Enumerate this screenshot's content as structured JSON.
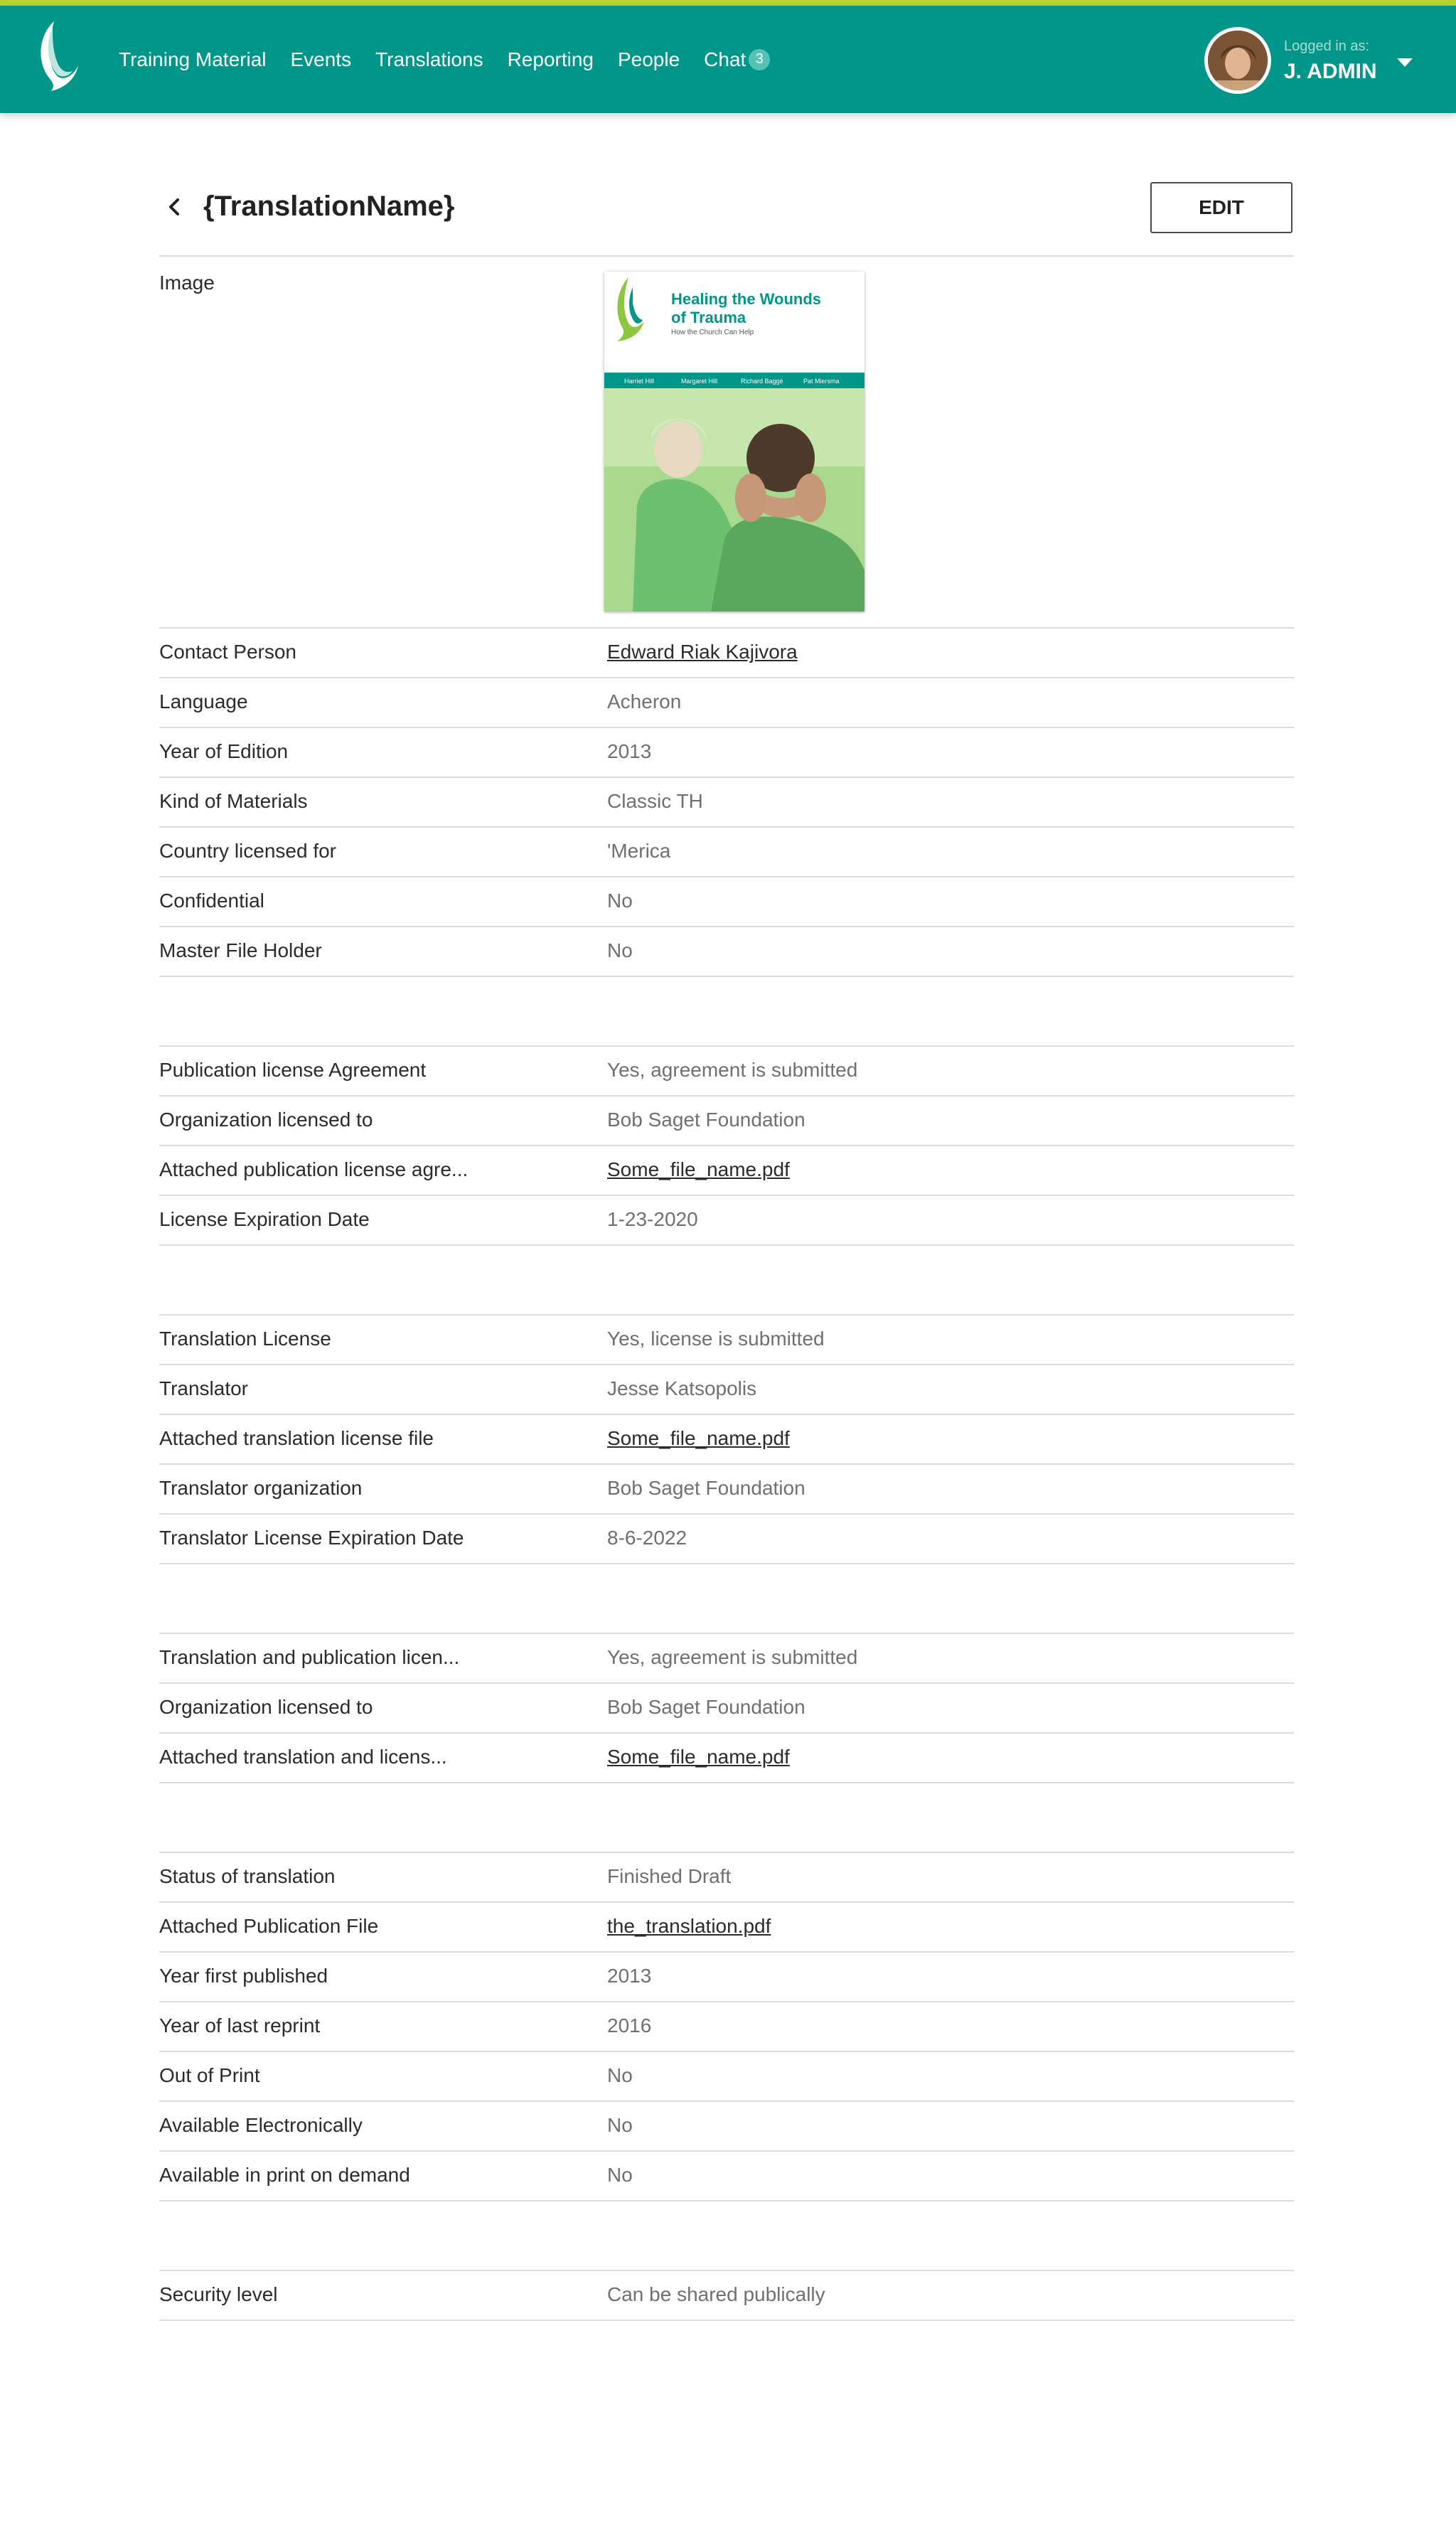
{
  "nav": {
    "items": [
      {
        "label": "Training Material"
      },
      {
        "label": "Events"
      },
      {
        "label": "Translations"
      },
      {
        "label": "Reporting"
      },
      {
        "label": "People"
      },
      {
        "label": "Chat",
        "badge": "3"
      }
    ]
  },
  "user": {
    "logged_in_label": "Logged in as:",
    "name": "J. ADMIN"
  },
  "page": {
    "title": "{TranslationName}",
    "edit_label": "EDIT"
  },
  "image_section": {
    "label": "Image"
  },
  "cover": {
    "title_line1": "Healing the Wounds",
    "title_line2": "of Trauma",
    "subtitle": "How the Church Can Help",
    "authors": [
      "Harriet Hill",
      "Margaret Hill",
      "Richard Baggé",
      "Pat Miersma"
    ]
  },
  "sections": [
    {
      "rows": [
        {
          "label": "Contact Person",
          "value": "Edward Riak Kajivora",
          "link": true
        },
        {
          "label": "Language",
          "value": "Acheron"
        },
        {
          "label": "Year of Edition",
          "value": "2013"
        },
        {
          "label": "Kind of Materials",
          "value": "Classic TH"
        },
        {
          "label": "Country licensed for",
          "value": "'Merica"
        },
        {
          "label": "Confidential",
          "value": "No"
        },
        {
          "label": "Master File Holder",
          "value": "No"
        }
      ]
    },
    {
      "rows": [
        {
          "label": "Publication license Agreement",
          "value": "Yes, agreement is submitted"
        },
        {
          "label": "Organization licensed to",
          "value": "Bob Saget Foundation"
        },
        {
          "label": "Attached publication license agre...",
          "value": "Some_file_name.pdf",
          "link": true
        },
        {
          "label": "License Expiration Date",
          "value": "1-23-2020"
        }
      ]
    },
    {
      "rows": [
        {
          "label": "Translation License",
          "value": "Yes, license is submitted"
        },
        {
          "label": "Translator",
          "value": "Jesse Katsopolis"
        },
        {
          "label": "Attached translation license file",
          "value": "Some_file_name.pdf",
          "link": true
        },
        {
          "label": "Translator organization",
          "value": "Bob Saget Foundation"
        },
        {
          "label": "Translator License Expiration Date",
          "value": "8-6-2022"
        }
      ]
    },
    {
      "rows": [
        {
          "label": "Translation and publication licen...",
          "value": "Yes, agreement is submitted"
        },
        {
          "label": "Organization licensed to",
          "value": "Bob Saget Foundation"
        },
        {
          "label": "Attached translation and licens...",
          "value": "Some_file_name.pdf",
          "link": true
        }
      ]
    },
    {
      "rows": [
        {
          "label": "Status of translation",
          "value": "Finished Draft"
        },
        {
          "label": "Attached Publication File",
          "value": "the_translation.pdf",
          "link": true
        },
        {
          "label": "Year first published",
          "value": "2013"
        },
        {
          "label": "Year of last reprint",
          "value": "2016"
        },
        {
          "label": "Out of Print",
          "value": "No"
        },
        {
          "label": "Available Electronically",
          "value": "No"
        },
        {
          "label": "Available in print on demand",
          "value": "No"
        }
      ]
    },
    {
      "rows": [
        {
          "label": "Security level",
          "value": "Can be shared publically"
        }
      ]
    }
  ]
}
